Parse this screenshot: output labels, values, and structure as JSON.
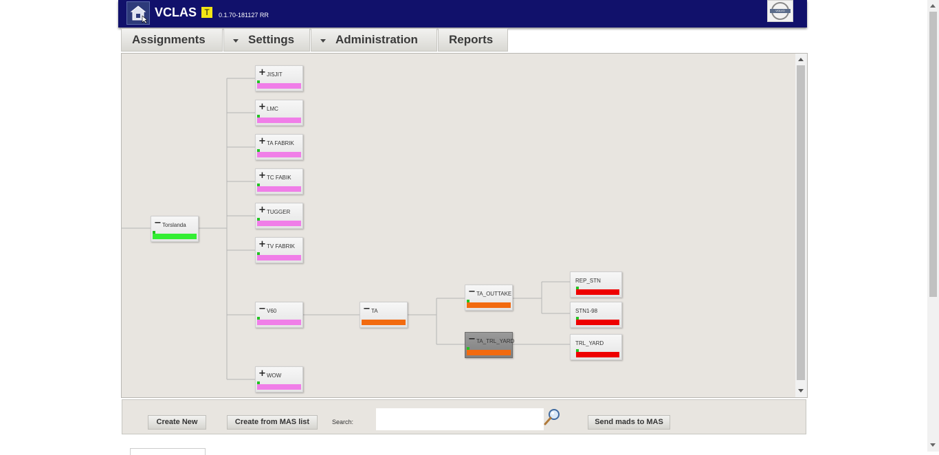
{
  "header": {
    "app_name": "VCLAS",
    "env_badge": "T",
    "version": "0.1.70-181127 RR",
    "logo_text": "VOLVO"
  },
  "tabs": [
    {
      "label": "Assignments",
      "dropdown": false
    },
    {
      "label": "Settings",
      "dropdown": true
    },
    {
      "label": "Administration",
      "dropdown": true
    },
    {
      "label": "Reports",
      "dropdown": false
    }
  ],
  "tree": {
    "status_colors": {
      "pink": "#f07ee8",
      "green": "#33ee33",
      "orange": "#f26a0f",
      "red": "#ee0000"
    },
    "nodes": [
      {
        "id": "torslanda",
        "label": "Torslanda",
        "toggle": "−",
        "status": "green"
      },
      {
        "id": "jisjit",
        "label": "JISJIT",
        "toggle": "+",
        "status": "pink"
      },
      {
        "id": "lmc",
        "label": "LMC",
        "toggle": "+",
        "status": "pink"
      },
      {
        "id": "ta-fabrik",
        "label": "TA FABRIK",
        "toggle": "+",
        "status": "pink"
      },
      {
        "id": "tc-fabik",
        "label": "TC FABIK",
        "toggle": "+",
        "status": "pink"
      },
      {
        "id": "tugger",
        "label": "TUGGER",
        "toggle": "+",
        "status": "pink"
      },
      {
        "id": "tv-fabrik",
        "label": "TV FABRIK",
        "toggle": "+",
        "status": "pink"
      },
      {
        "id": "v60",
        "label": "V60",
        "toggle": "−",
        "status": "pink"
      },
      {
        "id": "wow",
        "label": "WOW",
        "toggle": "+",
        "status": "pink"
      },
      {
        "id": "ta",
        "label": "TA",
        "toggle": "−",
        "status": "orange"
      },
      {
        "id": "ta-outtake",
        "label": "TA_OUTTAKE",
        "toggle": "−",
        "status": "orange"
      },
      {
        "id": "ta-trl-yard",
        "label": "TA_TRL_YARD",
        "toggle": "−",
        "status": "orange",
        "selected": true
      },
      {
        "id": "rep-stn",
        "label": "REP_STN",
        "toggle": "",
        "status": "red"
      },
      {
        "id": "stn1-98",
        "label": "STN1-98",
        "toggle": "",
        "status": "red"
      },
      {
        "id": "trl-yard",
        "label": "TRL_YARD",
        "toggle": "",
        "status": "red"
      }
    ]
  },
  "toolbar": {
    "create_new": "Create New",
    "create_from_mas": "Create from MAS list",
    "search_label": "Search:",
    "search_value": "",
    "send_mads": "Send mads to MAS"
  }
}
